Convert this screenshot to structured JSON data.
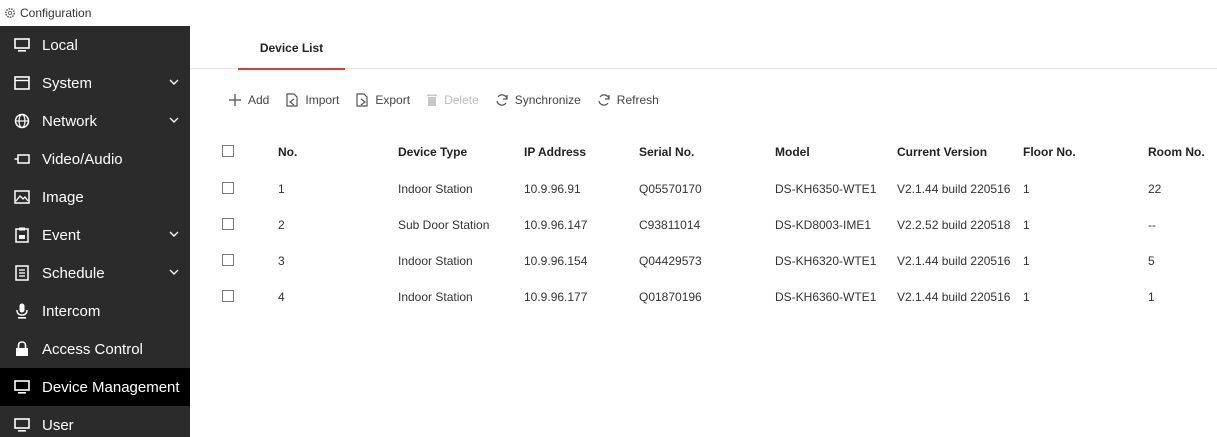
{
  "header": {
    "title": "Configuration",
    "icon": "gear-icon"
  },
  "sidebar": {
    "items": [
      {
        "label": "Local",
        "icon": "monitor-icon",
        "chevron": false,
        "active": false
      },
      {
        "label": "System",
        "icon": "window-icon",
        "chevron": true,
        "active": false
      },
      {
        "label": "Network",
        "icon": "globe-icon",
        "chevron": true,
        "active": false
      },
      {
        "label": "Video/Audio",
        "icon": "camera-icon",
        "chevron": false,
        "active": false
      },
      {
        "label": "Image",
        "icon": "image-icon",
        "chevron": false,
        "active": false
      },
      {
        "label": "Event",
        "icon": "calendar-icon",
        "chevron": true,
        "active": false
      },
      {
        "label": "Schedule",
        "icon": "schedule-icon",
        "chevron": true,
        "active": false
      },
      {
        "label": "Intercom",
        "icon": "microphone-icon",
        "chevron": false,
        "active": false
      },
      {
        "label": "Access Control",
        "icon": "lock-icon",
        "chevron": false,
        "active": false
      },
      {
        "label": "Device Management",
        "icon": "monitor-icon",
        "chevron": false,
        "active": true
      },
      {
        "label": "User",
        "icon": "user-icon",
        "chevron": false,
        "active": false
      }
    ]
  },
  "tabs": {
    "device_list": "Device List"
  },
  "toolbar": {
    "add": "Add",
    "import": "Import",
    "export": "Export",
    "delete": "Delete",
    "synchronize": "Synchronize",
    "refresh": "Refresh"
  },
  "table": {
    "headers": {
      "no": "No.",
      "device_type": "Device Type",
      "ip": "IP Address",
      "serial": "Serial No.",
      "model": "Model",
      "version": "Current Version",
      "floor": "Floor No.",
      "room": "Room No."
    },
    "rows": [
      {
        "no": "1",
        "device_type": "Indoor Station",
        "ip": "10.9.96.91",
        "serial": "Q05570170",
        "model": "DS-KH6350-WTE1",
        "version": "V2.1.44 build 220516",
        "floor": "1",
        "room": "22"
      },
      {
        "no": "2",
        "device_type": "Sub Door Station",
        "ip": "10.9.96.147",
        "serial": "C93811014",
        "model": "DS-KD8003-IME1",
        "version": "V2.2.52 build 220518",
        "floor": "1",
        "room": "--"
      },
      {
        "no": "3",
        "device_type": "Indoor Station",
        "ip": "10.9.96.154",
        "serial": "Q04429573",
        "model": "DS-KH6320-WTE1",
        "version": "V2.1.44 build 220516",
        "floor": "1",
        "room": "5"
      },
      {
        "no": "4",
        "device_type": "Indoor Station",
        "ip": "10.9.96.177",
        "serial": "Q01870196",
        "model": "DS-KH6360-WTE1",
        "version": "V2.1.44 build 220516",
        "floor": "1",
        "room": "1"
      }
    ]
  },
  "colors": {
    "sidebar_bg": "#2b2b2b",
    "active_bg": "#000000",
    "accent": "#e53935",
    "disabled": "#bdbdbd"
  }
}
